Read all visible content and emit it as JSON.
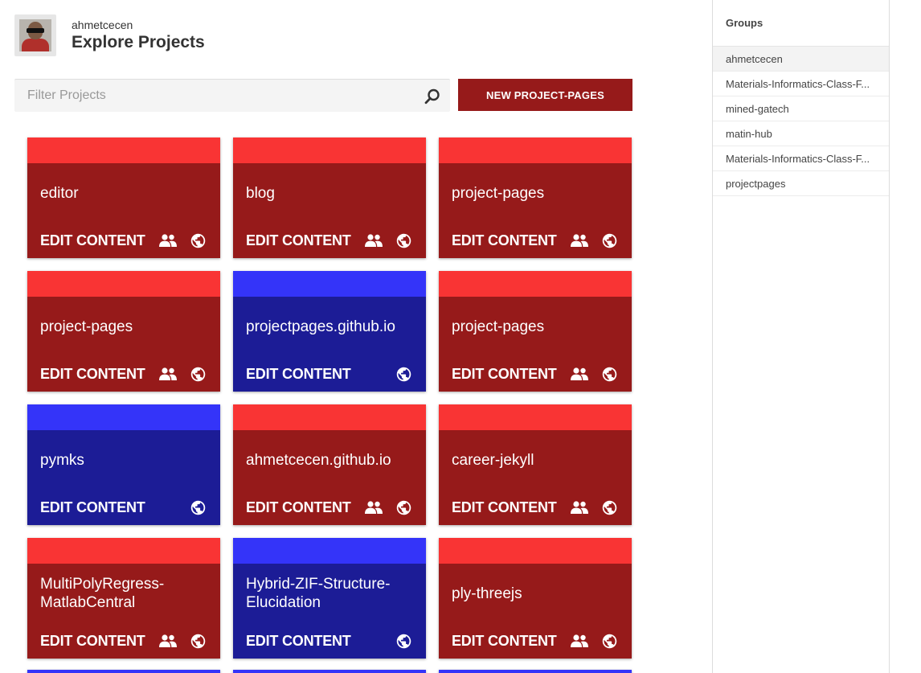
{
  "header": {
    "username": "ahmetcecen",
    "title": "Explore Projects"
  },
  "search": {
    "placeholder": "Filter Projects",
    "value": ""
  },
  "new_button_label": "NEW PROJECT-PAGES",
  "colors": {
    "red_bar": "#f93434",
    "red_body": "#961a1a",
    "blue_bar": "#3434f9",
    "blue_body": "#1c1c96"
  },
  "projects": [
    {
      "name": "editor",
      "color": "red",
      "action": "EDIT CONTENT",
      "shared": true,
      "public": true
    },
    {
      "name": "blog",
      "color": "red",
      "action": "EDIT CONTENT",
      "shared": true,
      "public": true
    },
    {
      "name": "project-pages",
      "color": "red",
      "action": "EDIT CONTENT",
      "shared": true,
      "public": true
    },
    {
      "name": "project-pages",
      "color": "red",
      "action": "EDIT CONTENT",
      "shared": true,
      "public": true
    },
    {
      "name": "projectpages.github.io",
      "color": "blue",
      "action": "EDIT CONTENT",
      "shared": false,
      "public": true
    },
    {
      "name": "project-pages",
      "color": "red",
      "action": "EDIT CONTENT",
      "shared": true,
      "public": true
    },
    {
      "name": "pymks",
      "color": "blue",
      "action": "EDIT CONTENT",
      "shared": false,
      "public": true
    },
    {
      "name": "ahmetcecen.github.io",
      "color": "red",
      "action": "EDIT CONTENT",
      "shared": true,
      "public": true
    },
    {
      "name": "career-jekyll",
      "color": "red",
      "action": "EDIT CONTENT",
      "shared": true,
      "public": true
    },
    {
      "name": "MultiPolyRegress-MatlabCentral",
      "color": "red",
      "action": "EDIT CONTENT",
      "shared": true,
      "public": true
    },
    {
      "name": "Hybrid-ZIF-Structure-Elucidation",
      "color": "blue",
      "action": "EDIT CONTENT",
      "shared": false,
      "public": true
    },
    {
      "name": "ply-threejs",
      "color": "red",
      "action": "EDIT CONTENT",
      "shared": true,
      "public": true
    }
  ],
  "sidebar": {
    "title": "Groups",
    "items": [
      {
        "label": "ahmetcecen",
        "active": true
      },
      {
        "label": "Materials-Informatics-Class-F...",
        "active": false
      },
      {
        "label": "mined-gatech",
        "active": false
      },
      {
        "label": "matin-hub",
        "active": false
      },
      {
        "label": "Materials-Informatics-Class-F...",
        "active": false
      },
      {
        "label": "projectpages",
        "active": false
      }
    ]
  }
}
